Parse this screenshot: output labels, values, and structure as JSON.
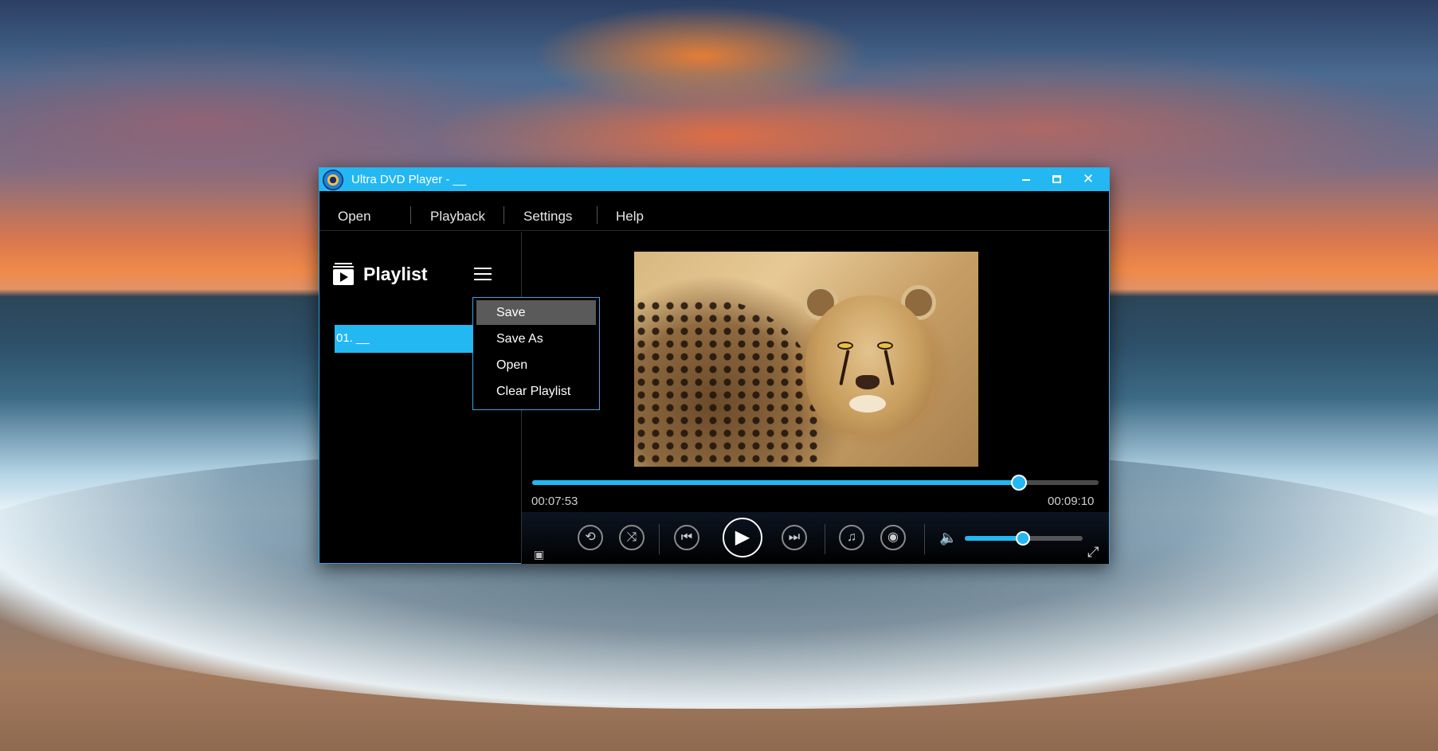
{
  "window": {
    "title": "Ultra DVD Player - __",
    "accent_color": "#23b8f2",
    "controls": {
      "minimize_icon": "minimize-icon",
      "maximize_icon": "maximize-icon",
      "close_icon": "close-icon",
      "close_glyph": "✕"
    }
  },
  "menubar": {
    "items": [
      {
        "label": "Open"
      },
      {
        "label": "Playback"
      },
      {
        "label": "Settings"
      },
      {
        "label": "Help"
      }
    ]
  },
  "sidebar": {
    "title": "Playlist",
    "icon": "playlist-icon",
    "menu_icon": "hamburger-menu-icon",
    "items": [
      {
        "label": "01. __",
        "selected": true
      }
    ]
  },
  "dropdown": {
    "items": [
      {
        "label": "Save",
        "active": true
      },
      {
        "label": "Save As"
      },
      {
        "label": "Open"
      },
      {
        "label": "Clear Playlist"
      }
    ]
  },
  "player": {
    "current_time": "00:07:53",
    "total_time": "00:09:10",
    "progress_fraction": 0.86,
    "volume_fraction": 0.49,
    "controls": [
      {
        "icon": "repeat-icon",
        "glyph": "⟲"
      },
      {
        "icon": "shuffle-icon",
        "glyph": "⤨"
      },
      {
        "icon": "previous-icon",
        "glyph": "⏮"
      },
      {
        "icon": "play-icon",
        "glyph": "▶"
      },
      {
        "icon": "next-icon",
        "glyph": "⏭"
      },
      {
        "icon": "playlist-music-icon",
        "glyph": "♫"
      },
      {
        "icon": "stop-icon",
        "glyph": "◉"
      }
    ],
    "volume_icon": "volume-icon",
    "fullscreen_icon": "fullscreen-icon",
    "mini_playlist_icon": "mini-playlist-icon",
    "glyphs": {
      "volume": "🔈",
      "fullscreen": "⤢",
      "mini_playlist": "▣"
    }
  }
}
